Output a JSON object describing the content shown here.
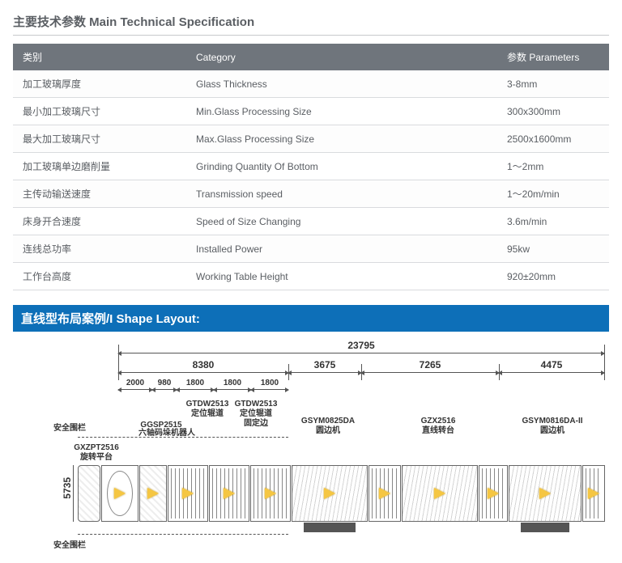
{
  "section_title": "主要技术参数  Main Technical Specification",
  "table": {
    "headers": {
      "cn": "类别",
      "en": "Category",
      "param": "参数 Parameters"
    },
    "rows": [
      {
        "cn": "加工玻璃厚度",
        "en": "Glass Thickness",
        "val": "3-8mm"
      },
      {
        "cn": "最小加工玻璃尺寸",
        "en": "Min.Glass Processing Size",
        "val": "300x300mm"
      },
      {
        "cn": "最大加工玻璃尺寸",
        "en": "Max.Glass Processing Size",
        "val": "2500x1600mm"
      },
      {
        "cn": "加工玻璃单边磨削量",
        "en": "Grinding Quantity Of Bottom",
        "val": "1～2mm"
      },
      {
        "cn": "主传动输送速度",
        "en": "Transmission speed",
        "val": "1～20m/min"
      },
      {
        "cn": "床身开合速度",
        "en": "Speed of Size Changing",
        "val": "3.6m/min"
      },
      {
        "cn": "连线总功率",
        "en": "Installed Power",
        "val": "95kw"
      },
      {
        "cn": "工作台高度",
        "en": "Working Table Height",
        "val": "920±20mm"
      }
    ]
  },
  "layout_title": "直线型布局案例/I Shape Layout:",
  "dims": {
    "total": "23795",
    "seg": [
      "8380",
      "3675",
      "7265",
      "4475"
    ],
    "sub": [
      "2000",
      "980",
      "1800",
      "1800",
      "1800"
    ],
    "height": "5735"
  },
  "labels": {
    "fence_top": "安全围栏",
    "fence_bottom": "安全围栏",
    "rot_platform": {
      "code": "GXZPT2516",
      "cn": "旋转平台"
    },
    "robot": {
      "code": "GGSP2515",
      "cn": "六轴码垛机器人"
    },
    "pos_roller": {
      "code": "GTDW2513",
      "cn": "定位辊道"
    },
    "pos_roller2": {
      "code": "GTDW2513",
      "cn": "定位辊道",
      "ext": "固定边"
    },
    "edger1": {
      "code": "GSYM0825DA",
      "cn": "圆边机"
    },
    "turntable": {
      "code": "GZX2516",
      "cn": "直线转台"
    },
    "edger2": {
      "code": "GSYM0816DA-II",
      "cn": "圆边机"
    }
  }
}
